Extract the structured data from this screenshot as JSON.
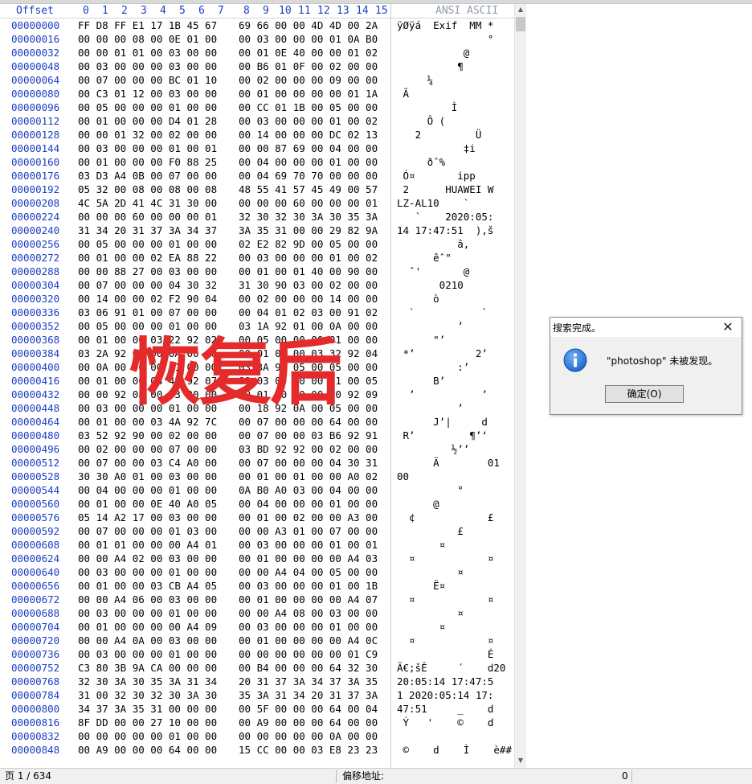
{
  "header": {
    "offset_label": "Offset",
    "columns": [
      "0",
      "1",
      "2",
      "3",
      "4",
      "5",
      "6",
      "7",
      "8",
      "9",
      "10",
      "11",
      "12",
      "13",
      "14",
      "15"
    ],
    "ansi_label": "ANSI ASCII"
  },
  "rows": [
    {
      "off": "00000000",
      "a": "FF D8 FF E1 17 1B 45 67",
      "b": "69 66 00 00 4D 4D 00 2A",
      "asc": "ÿØÿá  Exif  MM *"
    },
    {
      "off": "00000016",
      "a": "00 00 00 08 00 0E 01 00",
      "b": "00 03 00 00 00 01 0A B0",
      "asc": "               °"
    },
    {
      "off": "00000032",
      "a": "00 00 01 01 00 03 00 00",
      "b": "00 01 0E 40 00 00 01 02",
      "asc": "           @"
    },
    {
      "off": "00000048",
      "a": "00 03 00 00 00 03 00 00",
      "b": "00 B6 01 0F 00 02 00 00",
      "asc": "          ¶"
    },
    {
      "off": "00000064",
      "a": "00 07 00 00 00 BC 01 10",
      "b": "00 02 00 00 00 09 00 00",
      "asc": "     ¼"
    },
    {
      "off": "00000080",
      "a": "00 C3 01 12 00 03 00 00",
      "b": "00 01 00 00 00 00 01 1A",
      "asc": " Ã"
    },
    {
      "off": "00000096",
      "a": "00 05 00 00 00 01 00 00",
      "b": "00 CC 01 1B 00 05 00 00",
      "asc": "         Ì"
    },
    {
      "off": "00000112",
      "a": "00 01 00 00 00 D4 01 28",
      "b": "00 03 00 00 00 01 00 02",
      "asc": "     Ô ("
    },
    {
      "off": "00000128",
      "a": "00 00 01 32 00 02 00 00",
      "b": "00 14 00 00 00 DC 02 13",
      "asc": "   2         Ü"
    },
    {
      "off": "00000144",
      "a": "00 03 00 00 00 01 00 01",
      "b": "00 00 87 69 00 04 00 00",
      "asc": "           ‡i"
    },
    {
      "off": "00000160",
      "a": "00 01 00 00 00 F0 88 25",
      "b": "00 04 00 00 00 01 00 00",
      "asc": "     ðˆ%"
    },
    {
      "off": "00000176",
      "a": "03 D3 A4 0B 00 07 00 00",
      "b": "00 04 69 70 70 00 00 00",
      "asc": " Ó¤       ipp"
    },
    {
      "off": "00000192",
      "a": "05 32 00 08 00 08 00 08",
      "b": "48 55 41 57 45 49 00 57",
      "asc": " 2      HUAWEI W"
    },
    {
      "off": "00000208",
      "a": "4C 5A 2D 41 4C 31 30 00",
      "b": "00 00 00 60 00 00 00 01",
      "asc": "LZ-AL10    `"
    },
    {
      "off": "00000224",
      "a": "00 00 00 60 00 00 00 01",
      "b": "32 30 32 30 3A 30 35 3A",
      "asc": "   `    2020:05:"
    },
    {
      "off": "00000240",
      "a": "31 34 20 31 37 3A 34 37",
      "b": "3A 35 31 00 00 29 82 9A",
      "asc": "14 17:47:51  ),š"
    },
    {
      "off": "00000256",
      "a": "00 05 00 00 00 01 00 00",
      "b": "02 E2 82 9D 00 05 00 00",
      "asc": "          â,"
    },
    {
      "off": "00000272",
      "a": "00 01 00 00 02 EA 88 22",
      "b": "00 03 00 00 00 01 00 02",
      "asc": "      êˆ\""
    },
    {
      "off": "00000288",
      "a": "00 00 88 27 00 03 00 00",
      "b": "00 01 00 01 40 00 90 00",
      "asc": "  ˆ'       @"
    },
    {
      "off": "00000304",
      "a": "00 07 00 00 00 04 30 32",
      "b": "31 30 90 03 00 02 00 00",
      "asc": "       0210"
    },
    {
      "off": "00000320",
      "a": "00 14 00 00 02 F2 90 04",
      "b": "00 02 00 00 00 14 00 00",
      "asc": "      ò"
    },
    {
      "off": "00000336",
      "a": "03 06 91 01 00 07 00 00",
      "b": "00 04 01 02 03 00 91 02",
      "asc": "  `           `"
    },
    {
      "off": "00000352",
      "a": "00 05 00 00 00 01 00 00",
      "b": "03 1A 92 01 00 0A 00 00",
      "asc": "          ’"
    },
    {
      "off": "00000368",
      "a": "00 01 00 00 03 22 92 02",
      "b": "00 05 00 00 00 01 00 00",
      "asc": "      \"’"
    },
    {
      "off": "00000384",
      "a": "03 2A 92 03 00 0A 00 00",
      "b": "00 01 00 00 03 32 92 04",
      "asc": " *’          2’"
    },
    {
      "off": "00000400",
      "a": "00 0A 00 00 00 01 00 00",
      "b": "03 3A 92 05 00 05 00 00",
      "asc": "          :’"
    },
    {
      "off": "00000416",
      "a": "00 01 00 00 03 42 92 07",
      "b": "00 03 00 00 00 01 00 05",
      "asc": "      B’"
    },
    {
      "off": "00000432",
      "a": "00 00 92 08 00 03 00 00",
      "b": "00 01 00 00 00 00 92 09",
      "asc": "  ’           ’"
    },
    {
      "off": "00000448",
      "a": "00 03 00 00 00 01 00 00",
      "b": "00 18 92 0A 00 05 00 00",
      "asc": "          ’"
    },
    {
      "off": "00000464",
      "a": "00 01 00 00 03 4A 92 7C",
      "b": "00 07 00 00 00 64 00 00",
      "asc": "      J’|     d"
    },
    {
      "off": "00000480",
      "a": "03 52 92 90 00 02 00 00",
      "b": "00 07 00 00 03 B6 92 91",
      "asc": " R’         ¶’‘"
    },
    {
      "off": "00000496",
      "a": "00 02 00 00 00 07 00 00",
      "b": "03 BD 92 92 00 02 00 00",
      "asc": "         ½’’"
    },
    {
      "off": "00000512",
      "a": "00 07 00 00 03 C4 A0 00",
      "b": "00 07 00 00 00 04 30 31",
      "asc": "      Ä        01"
    },
    {
      "off": "00000528",
      "a": "30 30 A0 01 00 03 00 00",
      "b": "00 01 00 01 00 00 A0 02",
      "asc": "00"
    },
    {
      "off": "00000544",
      "a": "00 04 00 00 00 01 00 00",
      "b": "0A B0 A0 03 00 04 00 00",
      "asc": "          °"
    },
    {
      "off": "00000560",
      "a": "00 01 00 00 0E 40 A0 05",
      "b": "00 04 00 00 00 01 00 00",
      "asc": "      @"
    },
    {
      "off": "00000576",
      "a": "05 14 A2 17 00 03 00 00",
      "b": "00 01 00 02 00 00 A3 00",
      "asc": "  ¢            £"
    },
    {
      "off": "00000592",
      "a": "00 07 00 00 00 01 03 00",
      "b": "00 00 A3 01 00 07 00 00",
      "asc": "          £"
    },
    {
      "off": "00000608",
      "a": "00 01 01 00 00 00 A4 01",
      "b": "00 03 00 00 00 01 00 01",
      "asc": "       ¤"
    },
    {
      "off": "00000624",
      "a": "00 00 A4 02 00 03 00 00",
      "b": "00 01 00 00 00 00 A4 03",
      "asc": "  ¤            ¤"
    },
    {
      "off": "00000640",
      "a": "00 03 00 00 00 01 00 00",
      "b": "00 00 A4 04 00 05 00 00",
      "asc": "          ¤"
    },
    {
      "off": "00000656",
      "a": "00 01 00 00 03 CB A4 05",
      "b": "00 03 00 00 00 01 00 1B",
      "asc": "      Ë¤"
    },
    {
      "off": "00000672",
      "a": "00 00 A4 06 00 03 00 00",
      "b": "00 01 00 00 00 00 A4 07",
      "asc": "  ¤            ¤"
    },
    {
      "off": "00000688",
      "a": "00 03 00 00 00 01 00 00",
      "b": "00 00 A4 08 00 03 00 00",
      "asc": "          ¤"
    },
    {
      "off": "00000704",
      "a": "00 01 00 00 00 00 A4 09",
      "b": "00 03 00 00 00 01 00 00",
      "asc": "       ¤"
    },
    {
      "off": "00000720",
      "a": "00 00 A4 0A 00 03 00 00",
      "b": "00 01 00 00 00 00 A4 0C",
      "asc": "  ¤            ¤"
    },
    {
      "off": "00000736",
      "a": "00 03 00 00 00 01 00 00",
      "b": "00 00 00 00 00 00 01 C9",
      "asc": "               É"
    },
    {
      "off": "00000752",
      "a": "C3 80 3B 9A CA 00 00 00",
      "b": "00 B4 00 00 00 64 32 30",
      "asc": "Ã€;šÊ     ´    d20"
    },
    {
      "off": "00000768",
      "a": "32 30 3A 30 35 3A 31 34",
      "b": "20 31 37 3A 34 37 3A 35",
      "asc": "20:05:14 17:47:5"
    },
    {
      "off": "00000784",
      "a": "31 00 32 30 32 30 3A 30",
      "b": "35 3A 31 34 20 31 37 3A",
      "asc": "1 2020:05:14 17:"
    },
    {
      "off": "00000800",
      "a": "34 37 3A 35 31 00 00 00",
      "b": "00 5F 00 00 00 64 00 04",
      "asc": "47:51     _    d"
    },
    {
      "off": "00000816",
      "a": "8F DD 00 00 27 10 00 00",
      "b": "00 A9 00 00 00 64 00 00",
      "asc": " Ý   '    ©    d"
    },
    {
      "off": "00000832",
      "a": "00 00 00 00 00 01 00 00",
      "b": "00 00 00 00 00 0A 00 00",
      "asc": ""
    },
    {
      "off": "00000848",
      "a": "00 A9 00 00 00 64 00 00",
      "b": "15 CC 00 00 03 E8 23 23",
      "asc": " ©    d    Ì    è##"
    }
  ],
  "watermark": "恢复后",
  "dialog": {
    "title": "搜索完成。",
    "message": "\"photoshop\" 未被发现。",
    "ok_label": "确定(O)"
  },
  "status": {
    "page": "页 1 / 634",
    "offset_label": "偏移地址:",
    "offset_value": "0"
  },
  "colors": {
    "offset_blue": "#1a3ec4",
    "watermark_red": "#e42a2a",
    "info_blue": "#1c62c8"
  }
}
